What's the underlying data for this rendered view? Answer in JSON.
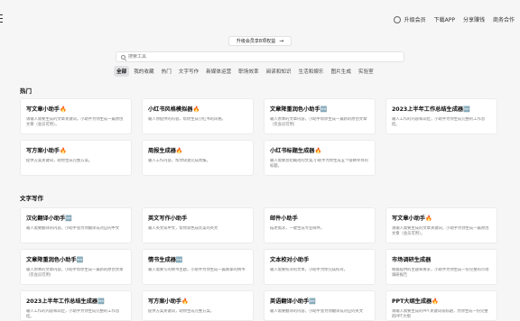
{
  "topnav": {
    "upgrade": "升级会员",
    "download": "下载APP",
    "share": "分享赚钱",
    "business": "商务合作"
  },
  "banner": {
    "label": "升级会员享8项权益",
    "arrow": "→"
  },
  "search": {
    "placeholder": "搜索工具"
  },
  "categories": [
    "全部",
    "我的收藏",
    "热门",
    "文字写作",
    "新媒体运营",
    "职场效率",
    "阅读和知识",
    "生活和娱乐",
    "图片生成",
    "实验室"
  ],
  "sections": {
    "hot": {
      "title": "热门",
      "cards": [
        {
          "title": "写文章小助手🔥",
          "desc": "请输入需要生成的文章关键词，小助手为你生成一篇原创文章（会员可用）。"
        },
        {
          "title": "小红书风格模拟器🔥",
          "desc": "输入你提供的内容，帮你生成小红书的风格。"
        },
        {
          "title": "文章降重润色小助手🆕",
          "desc": "输入原本的文章内容，小助手帮你生成一篇新的原创文章（仅会员可用）"
        },
        {
          "title": "2023上半年工作总结生成器🆕",
          "desc": "输入工作的内容和岗位，小助手为你生成完整的工作总结。"
        },
        {
          "title": "写方案小助手🔥",
          "desc": "提供方案关键词，助你生成完整方案。"
        },
        {
          "title": "周报生成器🔥",
          "desc": "输入工作内容，帮你快速完成周报。"
        },
        {
          "title": "小红书标题生成器🔥",
          "desc": "输入需要总结概括的文案,小助手为你生成五个吸睛夺目的标题。"
        }
      ]
    },
    "writing": {
      "title": "文字写作",
      "cards": [
        {
          "title": "汉化翻译小助手🆕",
          "desc": "输入需要翻译的内容，小助手会为你翻译成对应的中文"
        },
        {
          "title": "英文写作小助手",
          "desc": "输入英文或中文，帮你润色成优美的英文"
        },
        {
          "title": "邮件小助手",
          "desc": "描述需求，一键生成专业邮件。"
        },
        {
          "title": "写文章小助手🔥",
          "desc": "请输入需要生成的文章关键词，小助手为你生成一篇原创文章（会员可用）。"
        },
        {
          "title": "文章降重润色小助手🆕",
          "desc": "输入原本的文章内容，小助手帮你生成一篇新的原创文章（仅会员可用）"
        },
        {
          "title": "情书生成器🆕",
          "desc": "输入需要写的情书主题，小助手为你生成一篇真挚的情书"
        },
        {
          "title": "文本校对小助手",
          "desc": "输入需要校对的文本，小助手为你完成校对。"
        },
        {
          "title": "市场调研生成器",
          "desc": "根据提供的主题和要求，小助手为你生成一份完整的市场调研报告"
        },
        {
          "title": "2023上半年工作总结生成器🆕",
          "desc": "输入工作的内容和岗位，小助手为你生成完整的工作总结。"
        },
        {
          "title": "写方案小助手🔥",
          "desc": "提供方案关键词，助你生成完整方案。"
        },
        {
          "title": "英语翻译小助手🆕",
          "desc": "输入需要翻译的内容，小助手会为你翻译成对应的英文"
        },
        {
          "title": "PPT大纲生成器🔥",
          "desc": "请输入需要生成的PPT关键词或标题，为你生成一份完整的PPT大纲"
        }
      ]
    }
  }
}
